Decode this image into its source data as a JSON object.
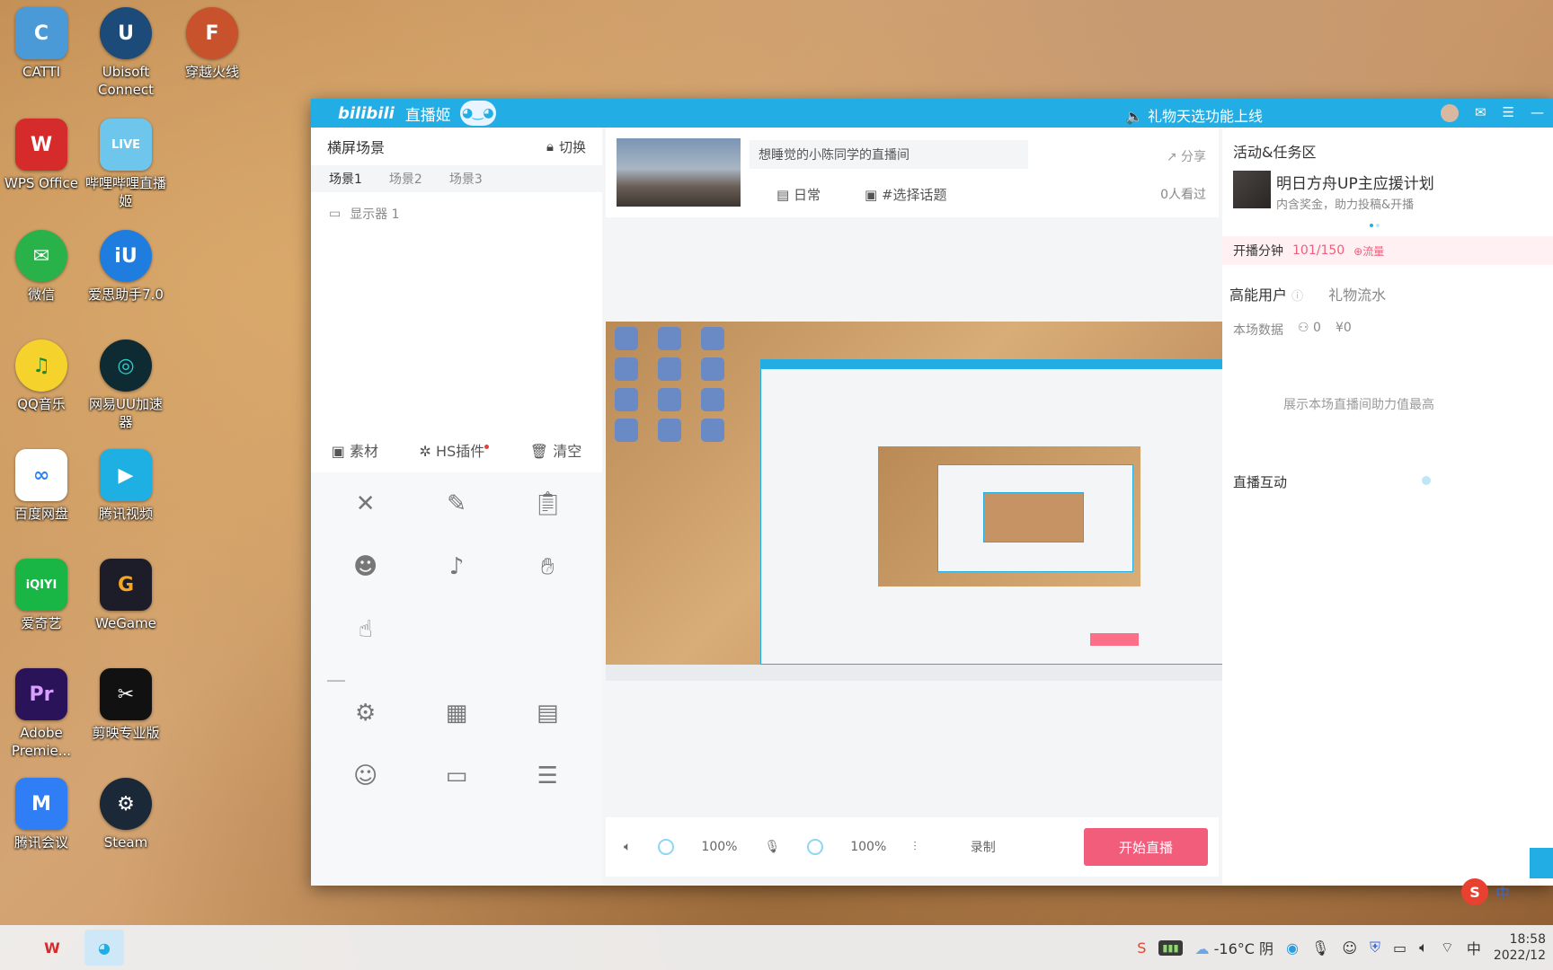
{
  "desktop": {
    "icons": [
      {
        "label": "CATTI",
        "color": "#4a9ad8",
        "glyph": "C"
      },
      {
        "label": "Ubisoft Connect",
        "color": "#1c4b7a",
        "glyph": "U"
      },
      {
        "label": "穿越火线",
        "color": "#c8522c",
        "glyph": "F"
      },
      {
        "label": "WPS Office",
        "color": "#d52b2b",
        "glyph": "W"
      },
      {
        "label": "哔哩哔哩直播姬",
        "color": "#6fc6ec",
        "glyph": "LIVE"
      },
      {
        "label": "微信",
        "color": "#2ab24a",
        "glyph": "✉"
      },
      {
        "label": "爱思助手7.0",
        "color": "#1f7de0",
        "glyph": "iU"
      },
      {
        "label": "QQ音乐",
        "color": "#f6d32c",
        "glyph": "♫"
      },
      {
        "label": "网易UU加速器",
        "color": "#0e2a33",
        "glyph": "◎"
      },
      {
        "label": "百度网盘",
        "color": "#2e83f2",
        "glyph": "∞"
      },
      {
        "label": "腾讯视频",
        "color": "#1fb0e3",
        "glyph": "▶"
      },
      {
        "label": "爱奇艺",
        "color": "#19b545",
        "glyph": "iQIYI"
      },
      {
        "label": "WeGame",
        "color": "#1d1d2a",
        "glyph": "G"
      },
      {
        "label": "Adobe Premie...",
        "color": "#2a1358",
        "glyph": "Pr"
      },
      {
        "label": "剪映专业版",
        "color": "#111111",
        "glyph": "✂"
      },
      {
        "label": "腾讯会议",
        "color": "#2f7ef5",
        "glyph": "M"
      },
      {
        "label": "Steam",
        "color": "#1b2838",
        "glyph": "⚙"
      }
    ]
  },
  "window": {
    "brand": "bilibili",
    "brand_sub": "直播姬",
    "notice": "礼物天选功能上线"
  },
  "left_panel": {
    "title": "横屏场景",
    "switch_label": "切换",
    "scene_tabs": [
      "场景1",
      "场景2",
      "场景3"
    ],
    "source": "显示器 1",
    "actions": {
      "material": "素材",
      "plugin": "HS插件",
      "clear": "清空"
    }
  },
  "center": {
    "room_title": "想睡觉的小陈同学的直播间",
    "share": "分享",
    "category": "日常",
    "topic": "#选择话题",
    "viewers": "0人看过",
    "controls": {
      "speaker_volume": "100%",
      "mic_volume": "100%",
      "record": "录制",
      "go_live": "开始直播"
    }
  },
  "right_panel": {
    "activity_title": "活动&任务区",
    "event_title": "明日方舟UP主应援计划",
    "event_sub": "内含奖金，助力投稿&开播",
    "minutes_label": "开播分钟",
    "minutes_value": "101/150",
    "minutes_flow": "⊕流量",
    "tab_high_users": "高能用户",
    "tab_gifts": "礼物流水",
    "stats_label": "本场数据",
    "stats_people": "0",
    "stats_money": "¥0",
    "empty_text": "展示本场直播间助力值最高",
    "interaction_title": "直播互动"
  },
  "taskbar": {
    "weather_temp": "-16°C",
    "weather_desc": "阴",
    "ime": "中",
    "time": "18:58",
    "date": "2022/12"
  }
}
